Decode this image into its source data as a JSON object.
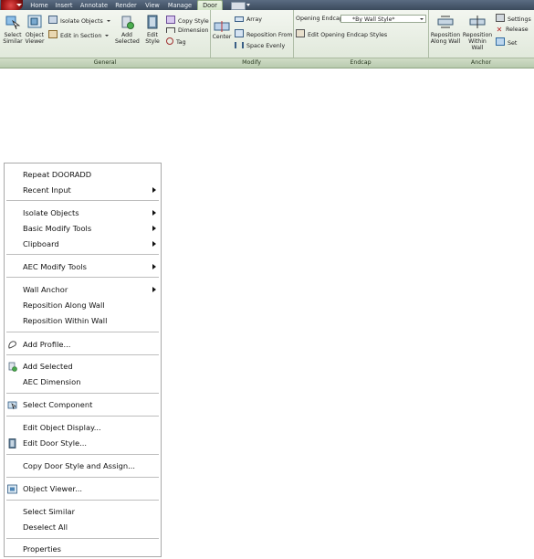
{
  "ribbon": {
    "tabs": [
      "Home",
      "Insert",
      "Annotate",
      "Render",
      "View",
      "Manage",
      "Door"
    ],
    "active_tab": "Door",
    "colors": {
      "tabbar": "#4a5a6e",
      "active_tab": "#dcebd3",
      "panel_bg": "#e8eee4",
      "panel_title": "#c3d3b9"
    },
    "general": {
      "title": "General",
      "select_similar": "Select Similar",
      "object_viewer": "Object Viewer",
      "isolate_objects": "Isolate Objects",
      "edit_in_section": "Edit in Section",
      "add_selected": "Add Selected",
      "edit_style": "Edit Style",
      "copy_style": "Copy Style",
      "dimension": "Dimension",
      "tag": "Tag"
    },
    "modify": {
      "title": "Modify",
      "center": "Center",
      "array": "Array",
      "reposition_from": "Reposition From",
      "space_evenly": "Space Evenly"
    },
    "endcap": {
      "title": "Endcap",
      "opening_endcap_label": "Opening Endcap",
      "opening_endcap_value": "*By Wall Style*",
      "edit_opening_endcap_styles": "Edit Opening Endcap Styles"
    },
    "anchor": {
      "title": "Anchor",
      "reposition_along_wall": "Reposition Along Wall",
      "reposition_within_wall": "Reposition Within Wall",
      "settings": "Settings",
      "release": "Release",
      "set": "Set"
    }
  },
  "menu": {
    "items": [
      {
        "label": "Repeat DOORADD",
        "submenu": false
      },
      {
        "label": "Recent Input",
        "submenu": true
      },
      {
        "label": "Isolate Objects",
        "submenu": true
      },
      {
        "label": "Basic Modify Tools",
        "submenu": true
      },
      {
        "label": "Clipboard",
        "submenu": true
      },
      {
        "label": "AEC Modify Tools",
        "submenu": true
      },
      {
        "label": "Wall Anchor",
        "submenu": true
      },
      {
        "label": "Reposition Along Wall",
        "submenu": false
      },
      {
        "label": "Reposition Within Wall",
        "submenu": false
      },
      {
        "label": "Add Profile...",
        "submenu": false,
        "icon": "profile-icon"
      },
      {
        "label": "Add Selected",
        "submenu": false,
        "icon": "add-selected-icon"
      },
      {
        "label": "AEC Dimension",
        "submenu": false
      },
      {
        "label": "Select Component",
        "submenu": false,
        "icon": "select-component-icon"
      },
      {
        "label": "Edit Object Display...",
        "submenu": false
      },
      {
        "label": "Edit Door Style...",
        "submenu": false,
        "icon": "door-style-icon"
      },
      {
        "label": "Copy Door Style and Assign...",
        "submenu": false
      },
      {
        "label": "Object Viewer...",
        "submenu": false,
        "icon": "object-viewer-icon"
      },
      {
        "label": "Select Similar",
        "submenu": false
      },
      {
        "label": "Deselect All",
        "submenu": false
      },
      {
        "label": "Properties",
        "submenu": false
      }
    ]
  }
}
